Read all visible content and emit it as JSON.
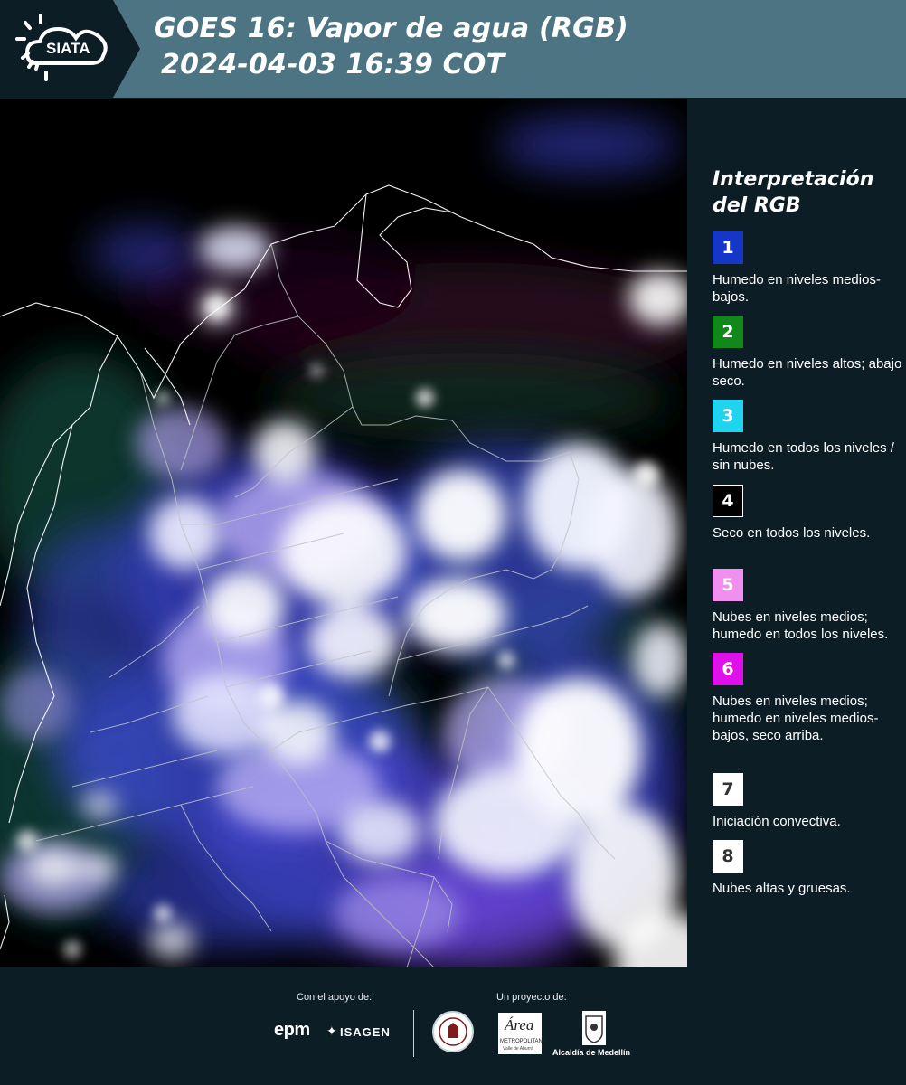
{
  "header": {
    "logo_text": "SIATA",
    "title_line1": "GOES 16: Vapor de agua (RGB)",
    "title_line2": "2024-04-03 16:39 COT"
  },
  "legend": {
    "title": "Interpretación del RGB",
    "items": [
      {
        "number": "1",
        "color": "#1536c6",
        "text_color": "#ffffff",
        "description": "Humedo en niveles medios-bajos."
      },
      {
        "number": "2",
        "color": "#11881a",
        "text_color": "#ffffff",
        "description": "Humedo en niveles altos; abajo seco."
      },
      {
        "number": "3",
        "color": "#1ed4ee",
        "text_color": "#ffffff",
        "description": "Humedo en todos los niveles / sin nubes."
      },
      {
        "number": "4",
        "color": "#000000",
        "text_color": "#ffffff",
        "description": "Seco en todos los niveles."
      },
      {
        "number": "5",
        "color": "#f08ff0",
        "text_color": "#ffffff",
        "description": "Nubes en niveles medios; humedo en todos los niveles."
      },
      {
        "number": "6",
        "color": "#e010ea",
        "text_color": "#ffffff",
        "description": "Nubes en niveles medios; humedo en niveles medios-bajos, seco arriba."
      },
      {
        "number": "7",
        "color": "#ffffff",
        "text_color": "#333333",
        "description": "Iniciación convectiva."
      },
      {
        "number": "8",
        "color": "#ffffff",
        "text_color": "#333333",
        "description": "Nubes altas y gruesas."
      }
    ]
  },
  "footer": {
    "support_caption": "Con el apoyo de:",
    "project_caption": "Un proyecto de:",
    "sponsor_epm": "epm",
    "sponsor_isagen": "ISAGEN",
    "partner_area_name": "Área",
    "partner_area_sub": "METROPOLITANA",
    "partner_area_sub2": "Valle de Aburrá",
    "partner_alcaldia": "Alcaldía de Medellín"
  }
}
